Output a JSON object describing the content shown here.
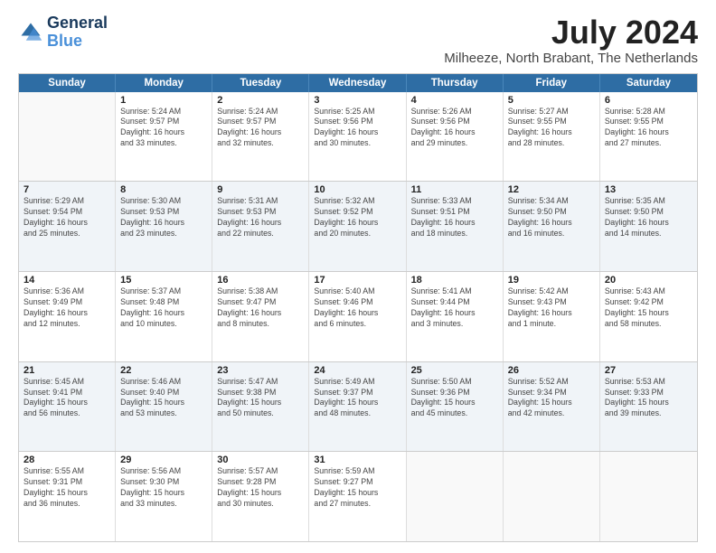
{
  "logo": {
    "line1": "General",
    "line2": "Blue"
  },
  "title": "July 2024",
  "subtitle": "Milheeze, North Brabant, The Netherlands",
  "calendar": {
    "headers": [
      "Sunday",
      "Monday",
      "Tuesday",
      "Wednesday",
      "Thursday",
      "Friday",
      "Saturday"
    ],
    "rows": [
      [
        {
          "day": "",
          "lines": []
        },
        {
          "day": "1",
          "lines": [
            "Sunrise: 5:24 AM",
            "Sunset: 9:57 PM",
            "Daylight: 16 hours",
            "and 33 minutes."
          ]
        },
        {
          "day": "2",
          "lines": [
            "Sunrise: 5:24 AM",
            "Sunset: 9:57 PM",
            "Daylight: 16 hours",
            "and 32 minutes."
          ]
        },
        {
          "day": "3",
          "lines": [
            "Sunrise: 5:25 AM",
            "Sunset: 9:56 PM",
            "Daylight: 16 hours",
            "and 30 minutes."
          ]
        },
        {
          "day": "4",
          "lines": [
            "Sunrise: 5:26 AM",
            "Sunset: 9:56 PM",
            "Daylight: 16 hours",
            "and 29 minutes."
          ]
        },
        {
          "day": "5",
          "lines": [
            "Sunrise: 5:27 AM",
            "Sunset: 9:55 PM",
            "Daylight: 16 hours",
            "and 28 minutes."
          ]
        },
        {
          "day": "6",
          "lines": [
            "Sunrise: 5:28 AM",
            "Sunset: 9:55 PM",
            "Daylight: 16 hours",
            "and 27 minutes."
          ]
        }
      ],
      [
        {
          "day": "7",
          "lines": [
            "Sunrise: 5:29 AM",
            "Sunset: 9:54 PM",
            "Daylight: 16 hours",
            "and 25 minutes."
          ]
        },
        {
          "day": "8",
          "lines": [
            "Sunrise: 5:30 AM",
            "Sunset: 9:53 PM",
            "Daylight: 16 hours",
            "and 23 minutes."
          ]
        },
        {
          "day": "9",
          "lines": [
            "Sunrise: 5:31 AM",
            "Sunset: 9:53 PM",
            "Daylight: 16 hours",
            "and 22 minutes."
          ]
        },
        {
          "day": "10",
          "lines": [
            "Sunrise: 5:32 AM",
            "Sunset: 9:52 PM",
            "Daylight: 16 hours",
            "and 20 minutes."
          ]
        },
        {
          "day": "11",
          "lines": [
            "Sunrise: 5:33 AM",
            "Sunset: 9:51 PM",
            "Daylight: 16 hours",
            "and 18 minutes."
          ]
        },
        {
          "day": "12",
          "lines": [
            "Sunrise: 5:34 AM",
            "Sunset: 9:50 PM",
            "Daylight: 16 hours",
            "and 16 minutes."
          ]
        },
        {
          "day": "13",
          "lines": [
            "Sunrise: 5:35 AM",
            "Sunset: 9:50 PM",
            "Daylight: 16 hours",
            "and 14 minutes."
          ]
        }
      ],
      [
        {
          "day": "14",
          "lines": [
            "Sunrise: 5:36 AM",
            "Sunset: 9:49 PM",
            "Daylight: 16 hours",
            "and 12 minutes."
          ]
        },
        {
          "day": "15",
          "lines": [
            "Sunrise: 5:37 AM",
            "Sunset: 9:48 PM",
            "Daylight: 16 hours",
            "and 10 minutes."
          ]
        },
        {
          "day": "16",
          "lines": [
            "Sunrise: 5:38 AM",
            "Sunset: 9:47 PM",
            "Daylight: 16 hours",
            "and 8 minutes."
          ]
        },
        {
          "day": "17",
          "lines": [
            "Sunrise: 5:40 AM",
            "Sunset: 9:46 PM",
            "Daylight: 16 hours",
            "and 6 minutes."
          ]
        },
        {
          "day": "18",
          "lines": [
            "Sunrise: 5:41 AM",
            "Sunset: 9:44 PM",
            "Daylight: 16 hours",
            "and 3 minutes."
          ]
        },
        {
          "day": "19",
          "lines": [
            "Sunrise: 5:42 AM",
            "Sunset: 9:43 PM",
            "Daylight: 16 hours",
            "and 1 minute."
          ]
        },
        {
          "day": "20",
          "lines": [
            "Sunrise: 5:43 AM",
            "Sunset: 9:42 PM",
            "Daylight: 15 hours",
            "and 58 minutes."
          ]
        }
      ],
      [
        {
          "day": "21",
          "lines": [
            "Sunrise: 5:45 AM",
            "Sunset: 9:41 PM",
            "Daylight: 15 hours",
            "and 56 minutes."
          ]
        },
        {
          "day": "22",
          "lines": [
            "Sunrise: 5:46 AM",
            "Sunset: 9:40 PM",
            "Daylight: 15 hours",
            "and 53 minutes."
          ]
        },
        {
          "day": "23",
          "lines": [
            "Sunrise: 5:47 AM",
            "Sunset: 9:38 PM",
            "Daylight: 15 hours",
            "and 50 minutes."
          ]
        },
        {
          "day": "24",
          "lines": [
            "Sunrise: 5:49 AM",
            "Sunset: 9:37 PM",
            "Daylight: 15 hours",
            "and 48 minutes."
          ]
        },
        {
          "day": "25",
          "lines": [
            "Sunrise: 5:50 AM",
            "Sunset: 9:36 PM",
            "Daylight: 15 hours",
            "and 45 minutes."
          ]
        },
        {
          "day": "26",
          "lines": [
            "Sunrise: 5:52 AM",
            "Sunset: 9:34 PM",
            "Daylight: 15 hours",
            "and 42 minutes."
          ]
        },
        {
          "day": "27",
          "lines": [
            "Sunrise: 5:53 AM",
            "Sunset: 9:33 PM",
            "Daylight: 15 hours",
            "and 39 minutes."
          ]
        }
      ],
      [
        {
          "day": "28",
          "lines": [
            "Sunrise: 5:55 AM",
            "Sunset: 9:31 PM",
            "Daylight: 15 hours",
            "and 36 minutes."
          ]
        },
        {
          "day": "29",
          "lines": [
            "Sunrise: 5:56 AM",
            "Sunset: 9:30 PM",
            "Daylight: 15 hours",
            "and 33 minutes."
          ]
        },
        {
          "day": "30",
          "lines": [
            "Sunrise: 5:57 AM",
            "Sunset: 9:28 PM",
            "Daylight: 15 hours",
            "and 30 minutes."
          ]
        },
        {
          "day": "31",
          "lines": [
            "Sunrise: 5:59 AM",
            "Sunset: 9:27 PM",
            "Daylight: 15 hours",
            "and 27 minutes."
          ]
        },
        {
          "day": "",
          "lines": []
        },
        {
          "day": "",
          "lines": []
        },
        {
          "day": "",
          "lines": []
        }
      ]
    ]
  }
}
